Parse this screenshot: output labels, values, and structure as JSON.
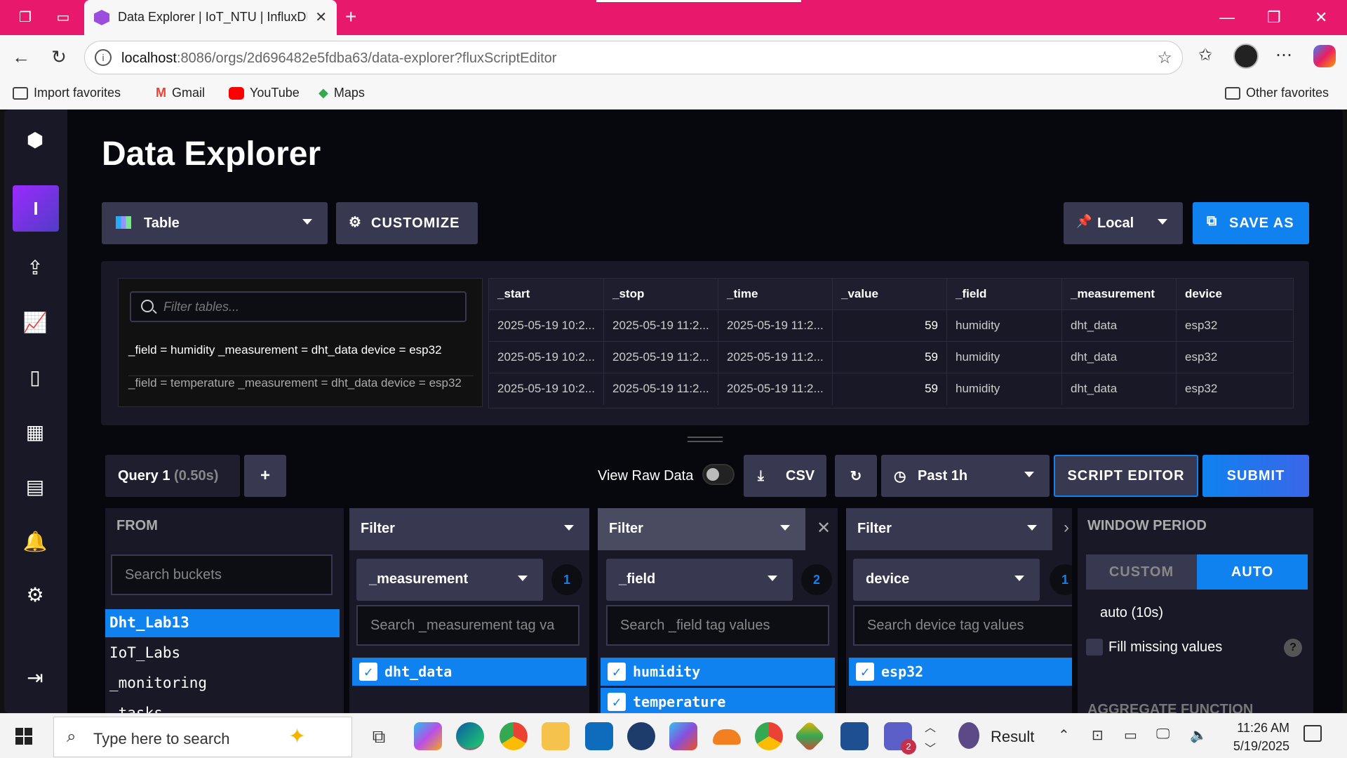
{
  "browser": {
    "tab_title": "Data Explorer | IoT_NTU | InfluxDB",
    "url_host": "localhost",
    "url_rest": ":8086/orgs/2d696482e5fdba63/data-explorer?fluxScriptEditor",
    "favorites": [
      "Import favorites",
      "Gmail",
      "YouTube",
      "Maps"
    ],
    "other_favorites": "Other favorites"
  },
  "page": {
    "title": "Data Explorer",
    "viz_type": "Table",
    "customize_label": "CUSTOMIZE",
    "timezone": "Local",
    "save_as_label": "SAVE AS"
  },
  "results": {
    "filter_placeholder": "Filter tables...",
    "tables": [
      "_field = humidity _measurement = dht_data device = esp32",
      "_field = temperature _measurement = dht_data device = esp32"
    ],
    "columns": [
      "_start",
      "_stop",
      "_time",
      "_value",
      "_field",
      "_measurement",
      "device"
    ],
    "rows": [
      [
        "2025-05-19 10:2...",
        "2025-05-19 11:2...",
        "2025-05-19 11:2...",
        "59",
        "humidity",
        "dht_data",
        "esp32"
      ],
      [
        "2025-05-19 10:2...",
        "2025-05-19 11:2...",
        "2025-05-19 11:2...",
        "59",
        "humidity",
        "dht_data",
        "esp32"
      ],
      [
        "2025-05-19 10:2...",
        "2025-05-19 11:2...",
        "2025-05-19 11:2...",
        "59",
        "humidity",
        "dht_data",
        "esp32"
      ]
    ]
  },
  "querybar": {
    "query_tab": "Query 1",
    "query_time": "(0.50s)",
    "add_label": "+",
    "raw_data_label": "View Raw Data",
    "csv_label": "CSV",
    "time_range": "Past 1h",
    "script_editor_label": "SCRIPT EDITOR",
    "submit_label": "SUBMIT"
  },
  "builder": {
    "from": {
      "header": "FROM",
      "search_placeholder": "Search buckets",
      "buckets": [
        "Dht_Lab13",
        "IoT_Labs",
        "_monitoring",
        "_tasks"
      ]
    },
    "filters": [
      {
        "header": "Filter",
        "key": "_measurement",
        "count": "1",
        "search": "Search _measurement tag va",
        "values": [
          "dht_data"
        ]
      },
      {
        "header": "Filter",
        "key": "_field",
        "count": "2",
        "search": "Search _field tag values",
        "values": [
          "humidity",
          "temperature"
        ]
      },
      {
        "header": "Filter",
        "key": "device",
        "count": "1",
        "search": "Search device tag values",
        "values": [
          "esp32"
        ]
      }
    ],
    "window": {
      "header": "WINDOW PERIOD",
      "custom_label": "CUSTOM",
      "auto_label": "AUTO",
      "auto_value": "auto (10s)",
      "fill_missing": "Fill missing values",
      "help": "?",
      "aggregate_header": "AGGREGATE FUNCTION"
    }
  },
  "taskbar": {
    "search_placeholder": "Type here to search",
    "result_label": "Result",
    "time": "11:26 AM",
    "date": "5/19/2025",
    "teams_badge": "2"
  }
}
